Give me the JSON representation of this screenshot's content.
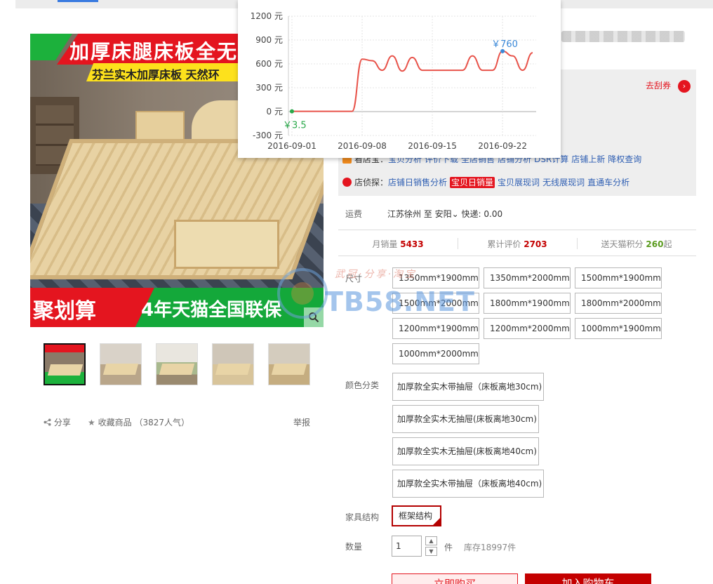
{
  "main_image": {
    "top_title": "加厚床腿床板全无",
    "top_subtitle": "芬兰实木加厚床板  天然环",
    "bottom_left": "聚划算",
    "bottom_right": "4年天猫全国联保"
  },
  "share": {
    "share_label": "分享",
    "favorite_label": "收藏商品",
    "favorite_count": "（3827人气）",
    "report_label": "举报"
  },
  "coupon_label": "去刮券",
  "tools": {
    "row1_items": [
      "宝贝分析",
      "评价下载",
      "全店销售",
      "店铺分析",
      "DSR计算",
      "店铺上新",
      "降权查询"
    ],
    "row1_prefix": "看店宝：",
    "row2_prefix": "店侦探：",
    "row2_items": [
      "店铺日销售分析",
      "宝贝日销量",
      "宝贝展现词",
      "无线展现词",
      "直通车分析"
    ]
  },
  "shipping": {
    "label": "运费",
    "value": "江苏徐州 至 安阳",
    "express": "快递: 0.00"
  },
  "stats": {
    "monthly_label": "月销量",
    "monthly_value": "5433",
    "reviews_label": "累计评价",
    "reviews_value": "2703",
    "points_label": "送天猫积分",
    "points_value": "260",
    "points_suffix": "起"
  },
  "sizes": {
    "label": "尺寸",
    "options": [
      "1350mm*1900mm",
      "1350mm*2000mm",
      "1500mm*1900mm",
      "1500mm*2000mm",
      "1800mm*1900mm",
      "1800mm*2000mm",
      "1200mm*1900mm",
      "1200mm*2000mm",
      "1000mm*1900mm",
      "1000mm*2000mm"
    ]
  },
  "colors": {
    "label": "颜色分类",
    "options": [
      "加厚款全实木带抽屉（床板离地30cm)",
      "加厚款全实木无抽屉(床板离地30cm)",
      "加厚款全实木无抽屉(床板离地40cm)",
      "加厚款全实木带抽屉（床板离地40cm)"
    ]
  },
  "structure": {
    "label": "家具结构",
    "selected": "框架结构"
  },
  "quantity": {
    "label": "数量",
    "value": "1",
    "unit": "件",
    "stock": "库存18997件"
  },
  "buttons": {
    "buy": "立即购买",
    "cart": "加入购物车"
  },
  "watermark": {
    "text": "TB58.NET",
    "cn": "武冠·分享·淘宝"
  },
  "colors_theme": {
    "accent": "#c40000",
    "link": "#2f5fb3",
    "chart_line": "#e8534a",
    "chart_max": "#3a88d8",
    "chart_min": "#2aa84a"
  },
  "chart_data": {
    "type": "line",
    "ylim": [
      -300,
      1200
    ],
    "yticks": [
      "1200 元",
      "900 元",
      "600 元",
      "300 元",
      "0 元",
      "-300 元"
    ],
    "xticks": [
      "2016-09-01",
      "2016-09-08",
      "2016-09-15",
      "2016-09-22"
    ],
    "max_label": "￥760",
    "min_label": "￥3.5",
    "x": [
      "09-01",
      "09-02",
      "09-03",
      "09-04",
      "09-05",
      "09-06",
      "09-07",
      "09-08",
      "09-09",
      "09-10",
      "09-11",
      "09-12",
      "09-13",
      "09-14",
      "09-15",
      "09-16",
      "09-17",
      "09-18",
      "09-19",
      "09-20",
      "09-21",
      "09-22",
      "09-23",
      "09-24",
      "09-25"
    ],
    "values": [
      3.5,
      3.5,
      3.5,
      3.5,
      3.5,
      3.5,
      3.5,
      660,
      640,
      520,
      700,
      510,
      680,
      520,
      520,
      520,
      520,
      520,
      700,
      520,
      520,
      760,
      700,
      520,
      740
    ]
  }
}
